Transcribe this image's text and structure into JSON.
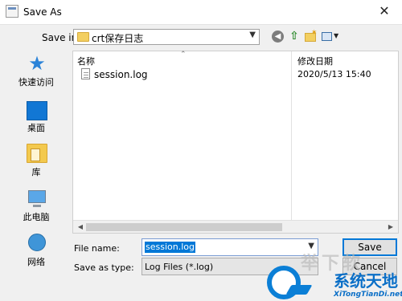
{
  "dialog": {
    "title": "Save As",
    "close_glyph": "✕"
  },
  "save_in": {
    "label": "Save in:",
    "value": "crt保存日志"
  },
  "toolbar": {
    "back_icon": "back-arrow-icon",
    "up_icon": "up-folder-icon",
    "new_folder_icon": "new-folder-icon",
    "view_icon": "view-menu-icon"
  },
  "sidebar": {
    "items": [
      {
        "label": "快速访问",
        "icon": "star-icon"
      },
      {
        "label": "桌面",
        "icon": "desktop-icon"
      },
      {
        "label": "库",
        "icon": "library-icon"
      },
      {
        "label": "此电脑",
        "icon": "computer-icon"
      },
      {
        "label": "网络",
        "icon": "network-icon"
      }
    ]
  },
  "file_list": {
    "columns": [
      "名称",
      "修改日期"
    ],
    "rows": [
      {
        "name": "session.log",
        "modified": "2020/5/13 15:40"
      }
    ]
  },
  "form": {
    "file_name_label": "File name:",
    "file_name_value": "session.log",
    "save_type_label": "Save as type:",
    "save_type_value": "Log Files (*.log)"
  },
  "buttons": {
    "save": "Save",
    "cancel": "Cancel"
  },
  "watermark": {
    "brand": "系统天地",
    "url": "XiTongTianDi.net",
    "ghost": "举下软"
  },
  "colors": {
    "accent": "#0078d7",
    "brand": "#0b7fd6"
  }
}
